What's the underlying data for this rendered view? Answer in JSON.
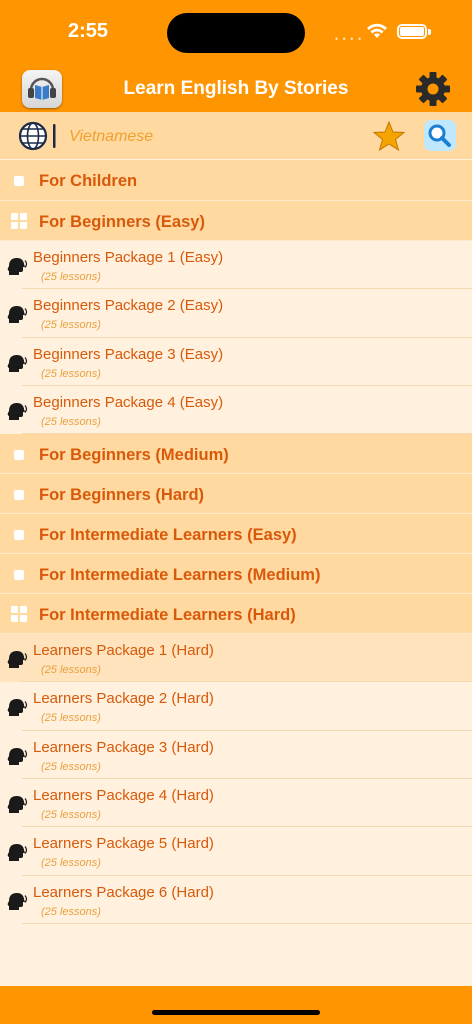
{
  "status": {
    "time": "2:55",
    "signal": "• • • •"
  },
  "nav": {
    "title": "Learn English By Stories"
  },
  "language": {
    "label": "Vietnamese"
  },
  "sections": [
    {
      "title": "For Children",
      "expanded": false,
      "rows": []
    },
    {
      "title": "For Beginners (Easy)",
      "expanded": true,
      "rows": [
        {
          "title": "Beginners Package 1 (Easy)",
          "sub": "(25 lessons)"
        },
        {
          "title": "Beginners Package 2 (Easy)",
          "sub": "(25 lessons)"
        },
        {
          "title": "Beginners Package 3 (Easy)",
          "sub": "(25 lessons)"
        },
        {
          "title": "Beginners Package 4 (Easy)",
          "sub": "(25 lessons)"
        }
      ]
    },
    {
      "title": "For Beginners (Medium)",
      "expanded": false,
      "rows": []
    },
    {
      "title": "For Beginners (Hard)",
      "expanded": false,
      "rows": []
    },
    {
      "title": "For Intermediate Learners (Easy)",
      "expanded": false,
      "rows": []
    },
    {
      "title": "For Intermediate Learners (Medium)",
      "expanded": false,
      "rows": []
    },
    {
      "title": "For Intermediate Learners (Hard)",
      "expanded": true,
      "rows": [
        {
          "title": "Learners Package 1 (Hard)",
          "sub": "(25 lessons)",
          "selected": true
        },
        {
          "title": "Learners Package 2 (Hard)",
          "sub": "(25 lessons)"
        },
        {
          "title": "Learners Package 3 (Hard)",
          "sub": "(25 lessons)"
        },
        {
          "title": "Learners Package 4 (Hard)",
          "sub": "(25 lessons)"
        },
        {
          "title": "Learners Package 5 (Hard)",
          "sub": "(25 lessons)"
        },
        {
          "title": "Learners Package 6 (Hard)",
          "sub": "(25 lessons)"
        }
      ]
    }
  ],
  "icons": {
    "app": "book-headphones-icon",
    "settings": "gear-icon",
    "language": "globe-icon",
    "favorite": "star-icon",
    "search": "search-icon",
    "lesson": "head-speaking-icon"
  },
  "colors": {
    "accent": "#FF9500",
    "section": "#FFD9A0",
    "background": "#FFF1DE",
    "text": "#D9590A"
  }
}
